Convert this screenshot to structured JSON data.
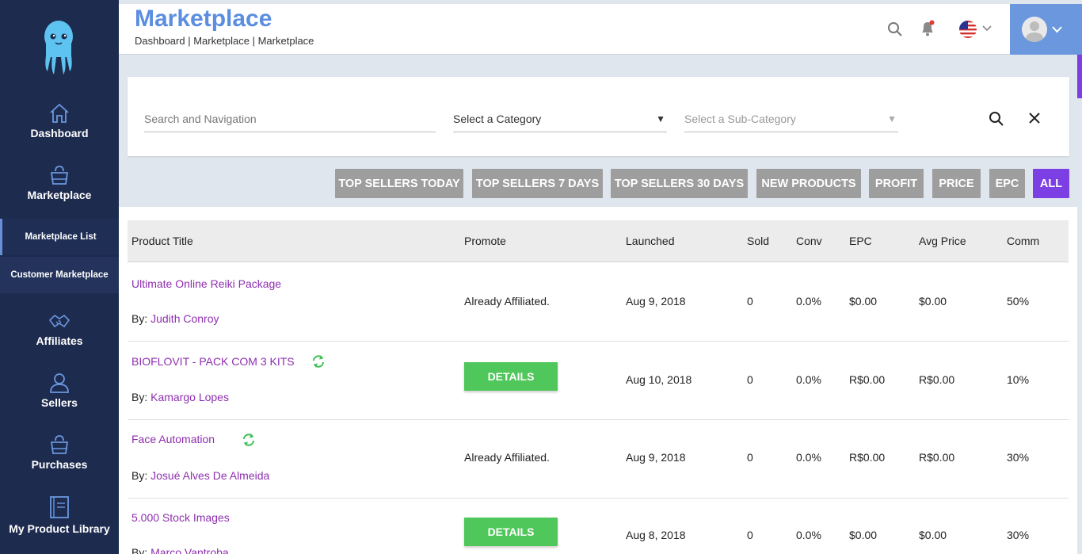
{
  "sidebar": {
    "items": [
      {
        "label": "Dashboard"
      },
      {
        "label": "Marketplace"
      },
      {
        "label": "Affiliates"
      },
      {
        "label": "Sellers"
      },
      {
        "label": "Purchases"
      },
      {
        "label": "My Product Library"
      }
    ],
    "subitems": [
      {
        "label": "Marketplace List"
      },
      {
        "label": "Customer Marketplace"
      }
    ]
  },
  "header": {
    "title": "Marketplace",
    "breadcrumb": "Dashboard | Marketplace | Marketplace"
  },
  "filters": {
    "search_placeholder": "Search and Navigation",
    "category_label": "Select a Category",
    "subcategory_label": "Select a Sub-Category"
  },
  "tabs": [
    {
      "label": "TOP SELLERS TODAY"
    },
    {
      "label": "TOP SELLERS 7 DAYS"
    },
    {
      "label": "TOP SELLERS 30 DAYS"
    },
    {
      "label": "NEW PRODUCTS"
    },
    {
      "label": "PROFIT"
    },
    {
      "label": "PRICE"
    },
    {
      "label": "EPC"
    },
    {
      "label": "ALL"
    }
  ],
  "table": {
    "columns": [
      "Product Title",
      "Promote",
      "Launched",
      "Sold",
      "Conv",
      "EPC",
      "Avg Price",
      "Comm"
    ],
    "by_prefix": "By:",
    "rows": [
      {
        "title": "Ultimate Online Reiki Package",
        "author": "Judith Conroy",
        "promote": "Already Affiliated.",
        "launched": "Aug 9, 2018",
        "sold": "0",
        "conv": "0.0%",
        "epc": "$0.00",
        "avg_price": "$0.00",
        "comm": "50%"
      },
      {
        "title": "BIOFLOVIT - PACK COM 3 KITS",
        "author": "Kamargo Lopes",
        "promote": "DETAILS",
        "launched": "Aug 10, 2018",
        "sold": "0",
        "conv": "0.0%",
        "epc": "R$0.00",
        "avg_price": "R$0.00",
        "comm": "10%"
      },
      {
        "title": "Face Automation",
        "author": "Josué Alves De Almeida",
        "promote": "Already Affiliated.",
        "launched": "Aug 9, 2018",
        "sold": "0",
        "conv": "0.0%",
        "epc": "R$0.00",
        "avg_price": "R$0.00",
        "comm": "30%"
      },
      {
        "title": "5.000 Stock Images",
        "author": "Marco Vantroba",
        "promote": "DETAILS",
        "launched": "Aug 8, 2018",
        "sold": "0",
        "conv": "0.0%",
        "epc": "$0.00",
        "avg_price": "$0.00",
        "comm": "30%"
      }
    ]
  },
  "colors": {
    "sidebar_bg": "#1d2b4f",
    "accent_blue": "#5b8ee0",
    "active_tab": "#7b3fe4",
    "details_green": "#4fc75a",
    "link_purple": "#8e2fb0"
  }
}
